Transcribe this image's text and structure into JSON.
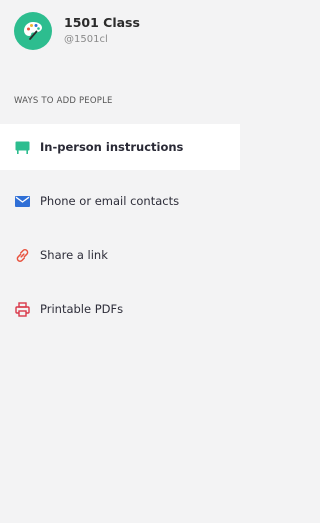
{
  "header": {
    "class_name": "1501 Class",
    "class_handle": "@1501cl",
    "avatar_icon": "palette-icon",
    "avatar_color": "#2dbd8f"
  },
  "section": {
    "title": "WAYS TO ADD PEOPLE"
  },
  "nav": {
    "items": [
      {
        "label": "In-person instructions",
        "icon": "chalkboard-icon",
        "color": "#2dbd8f",
        "active": true
      },
      {
        "label": "Phone or email contacts",
        "icon": "envelope-icon",
        "color": "#2f6fd6",
        "active": false
      },
      {
        "label": "Share a link",
        "icon": "link-icon",
        "color": "#e8533f",
        "active": false
      },
      {
        "label": "Printable PDFs",
        "icon": "printer-icon",
        "color": "#d9384a",
        "active": false
      }
    ]
  }
}
